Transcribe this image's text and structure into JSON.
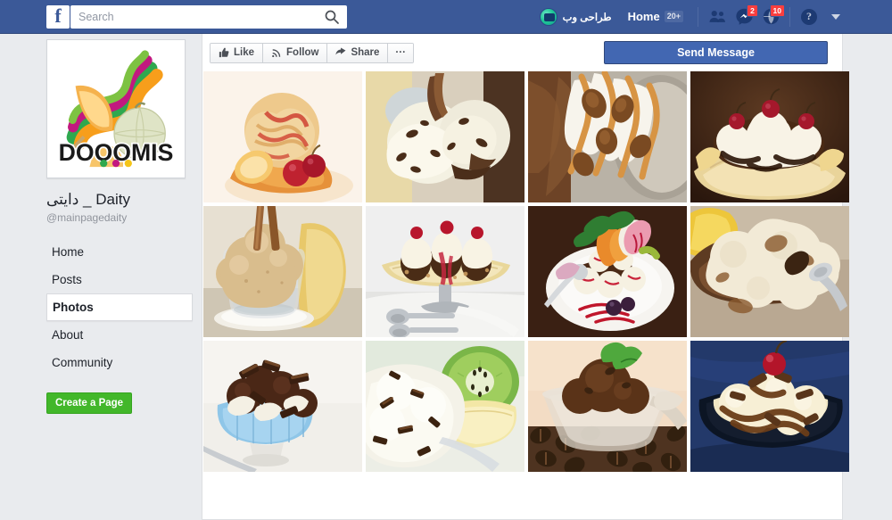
{
  "topbar": {
    "logo_letter": "f",
    "search": {
      "placeholder": "Search",
      "value": ""
    },
    "user_name": "طراحی وب",
    "home_label": "Home",
    "home_badge": "20+",
    "messages_badge": "2",
    "notifications_badge": "10",
    "help_glyph": "?",
    "accent_blue": "#3b5998"
  },
  "profile": {
    "name": "دایتی _ Daity",
    "handle": "@mainpagedaity",
    "logo_text": "DOOOMIS"
  },
  "sidebar": {
    "items": [
      {
        "label": "Home",
        "active": false
      },
      {
        "label": "Posts",
        "active": false
      },
      {
        "label": "Photos",
        "active": true
      },
      {
        "label": "About",
        "active": false
      },
      {
        "label": "Community",
        "active": false
      }
    ],
    "create_page_label": "Create a Page",
    "create_page_color": "#42b72a"
  },
  "actions": {
    "like_label": "Like",
    "follow_label": "Follow",
    "share_label": "Share",
    "more_label": "···",
    "send_message_label": "Send Message",
    "send_message_color": "#4267b2"
  },
  "photos": [
    {
      "alt": "Caramel swirl ice cream scoop with peach slice and cherries on autumn leaf"
    },
    {
      "alt": "Vanilla chocolate chip scoops with chocolate shavings"
    },
    {
      "alt": "Chocolate ice cream with whipped cream and caramel drizzle"
    },
    {
      "alt": "Banana split sundae with cherries and chocolate syrup"
    },
    {
      "alt": "Coffee ice cream in glass cup with cinnamon sticks and wafer"
    },
    {
      "alt": "Banana boat sundae with three scoops and cherries on pedestal"
    },
    {
      "alt": "Fruit and cream dessert plate with strawberry sauce design"
    },
    {
      "alt": "Toasted meringue ice cream bowl with spoon and lemon"
    },
    {
      "alt": "Chocolate ice cream in blue bowl with cookie chunks"
    },
    {
      "alt": "Vanilla chocolate chip ice cream with kiwi and banana"
    },
    {
      "alt": "Chocolate scoop in glass bowl with mint on coffee beans"
    },
    {
      "alt": "Banana split with cherry and caramel on dark tray"
    }
  ]
}
